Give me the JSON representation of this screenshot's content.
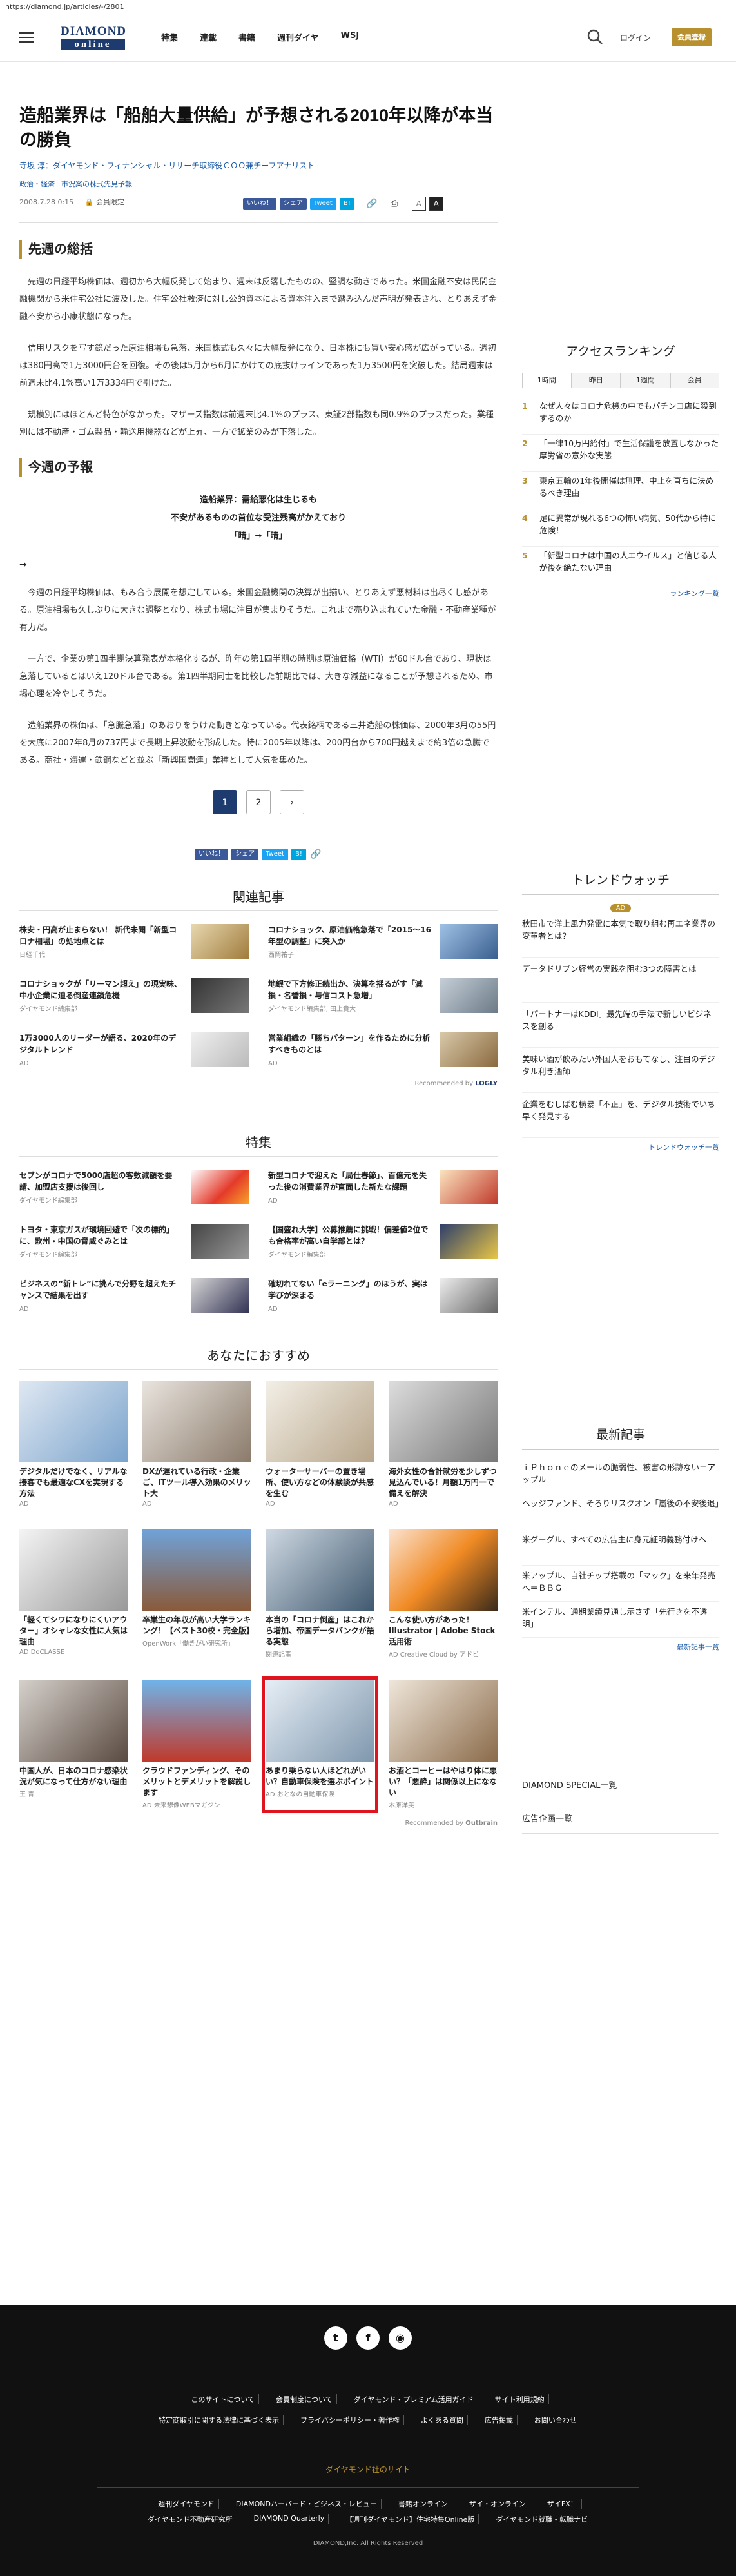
{
  "url": "https://diamond.jp/articles/-/2801",
  "header": {
    "logo_top": "DIAMOND",
    "logo_bottom": "online",
    "nav": [
      "特集",
      "連載",
      "書籍",
      "週刊ダイヤ",
      "WSJ"
    ],
    "login": "ログイン",
    "member": "会員登録"
  },
  "article": {
    "title": "造船業界は「船舶大量供給」が予想される2010年以降が本当の勝負",
    "author": "寺坂 淳：ダイヤモンド・フィナンシャル・リサーチ取締役ＣＯＯ兼チーフアナリスト",
    "tags": [
      "政治・経済",
      "市況案の株式先見予報"
    ],
    "date": "2008.7.28 0:15",
    "member_only": "会員限定",
    "share": {
      "fb": "いいね！",
      "fb2": "シェア",
      "tw": "Tweet",
      "hb": "B!"
    },
    "font_small": "A",
    "font_large": "A",
    "sec1": "先週の総括",
    "p1": "　先週の日経平均株価は、週初から大幅反発して始まり、週末は反落したものの、堅調な動きであった。米国金融不安は民間金融機関から米住宅公社に波及した。住宅公社救済に対し公的資本による資本注入まで踏み込んだ声明が発表され、とりあえず金融不安から小康状態になった。",
    "p2": "　信用リスクを写す鏡だった原油相場も急落、米国株式も久々に大幅反発になり、日本株にも買い安心感が広がっている。週初は380円高で1万3000円台を回復。その後は5月から6月にかけての底抜けラインであった1万3500円を突破した。結局週末は前週末比4.1%高い1万3334円で引けた。",
    "p3": "　規模別にはほとんど特色がなかった。マザーズ指数は前週末比4.1%のプラス、東証2部指数も同0.9%のプラスだった。業種別には不動産・ゴム製品・輸送用機器などが上昇、一方で鉱業のみが下落した。",
    "sec2": "今週の予報",
    "forecast": [
      "造船業界：需給悪化は生じるも",
      "不安があるものの首位な受注残高がかえており",
      "「晴」→「晴」"
    ],
    "arrow": "→",
    "p4": "　今週の日経平均株価は、もみ合う展開を想定している。米国金融機関の決算が出揃い、とりあえず悪材料は出尽くし感がある。原油相場も久しぶりに大きな調整となり、株式市場に注目が集まりそうだ。これまで売り込まれていた金融・不動産業種が有力だ。",
    "p5": "　一方で、企業の第1四半期決算発表が本格化するが、昨年の第1四半期の時期は原油価格（WTI）が60ドル台であり、現状は急落しているとはいえ120ドル台である。第1四半期同士を比較した前期比では、大きな減益になることが予想されるため、市場心理を冷やしそうだ。",
    "p6": "　造船業界の株価は、「急騰急落」のあおりをうけた動きとなっている。代表銘柄である三井造船の株価は、2000年3月の55円を大底に2007年8月の737円まで長期上昇波動を形成した。特に2005年以降は、200円台から700円越えまで約3倍の急騰である。商社・海運・鉄鋼などと並ぶ「新興国関連」業種として人気を集めた。",
    "pages": [
      "1",
      "2",
      "›"
    ]
  },
  "related": {
    "head": "関連記事",
    "items": [
      {
        "t": "株安・円高が止まらない！ 新代未聞「新型コロナ相場」の処地点とは",
        "s": "日経千代"
      },
      {
        "t": "コロナショック、原油価格急落で「2015～16年型の調整」に突入か",
        "s": "西岡祐子"
      },
      {
        "t": "コロナショックが「リーマン超え」の現実味、中小企業に迫る倒産連鎖危機",
        "s": "ダイヤモンド編集部"
      },
      {
        "t": "地銀で下方修正続出か、決算を揺るがす「減損・名誉損・与信コスト急増」",
        "s": "ダイヤモンド編集部, 田上貴大"
      },
      {
        "t": "1万3000人のリーダーが語る、2020年のデジタルトレンド",
        "s": "AD"
      },
      {
        "t": "営業組織の「勝ちパターン」を作るために分析すべきものとは",
        "s": "AD"
      }
    ],
    "rec_by": "Recommended by",
    "rec_brand": "LOGLY"
  },
  "feature": {
    "head": "特集",
    "items": [
      {
        "t": "セブンがコロナで5000店超の客数減額を要請、加盟店支援は後回し",
        "s": "ダイヤモンド編集部"
      },
      {
        "t": "新型コロナで迎えた「局仕春節」、百億元を失った後の消費業界が直面した新たな課題",
        "s": "AD"
      },
      {
        "t": "トヨタ・東京ガスが環境回避で「次の標的」に、欧州・中国の脅威ぐみとは",
        "s": "ダイヤモンド編集部"
      },
      {
        "t": "【国盛れ大学】公募推薦に挑戦！偏差値2位でも合格率が高い自学部とは？",
        "s": "ダイヤモンド編集部"
      },
      {
        "t": "ビジネスの”新トレ”に挑んで分野を超えたチャンスで結果を出す",
        "s": "AD"
      },
      {
        "t": "確切れてない「eラーニング」のほうが、実は学びが深まる",
        "s": "AD"
      }
    ]
  },
  "recommend": {
    "head": "あなたにおすすめ",
    "items": [
      {
        "t": "デジタルだけでなく、リアルな接客でも最適なCXを実現する方法",
        "s": "AD"
      },
      {
        "t": "DXが遅れている行政・企業ご、ITツール導入効果のメリット大",
        "s": "AD"
      },
      {
        "t": "ウォーターサーバーの置き場所、使い方などの体験談が共感を生む",
        "s": "AD"
      },
      {
        "t": "海外女性の合計就労を少しずつ見込んでいる！月額1万円一で備えを解決",
        "s": "AD"
      },
      {
        "t": "「軽くてシワになりにくいアウター」オシャレな女性に人気は理由",
        "s": "AD DoCLASSE"
      },
      {
        "t": "卒業生の年収が高い大学ランキング！【ベスト30校・完全版】",
        "s": "OpenWork「働きがい研究所」"
      },
      {
        "t": "本当の「コロナ倒産」はこれから増加、帝国データバンクが語る実態",
        "s": "関連記事"
      },
      {
        "t": "こんな使い方があった！Illustrator | Adobe Stock活用術",
        "s": "AD Creative Cloud by アドビ"
      },
      {
        "t": "中国人が、日本のコロナ感染状況が気になって仕方がない理由",
        "s": "王 青"
      },
      {
        "t": "クラウドファンディング、そのメリットとデメリットを解説します",
        "s": "AD 未来想像WEBマガジン"
      },
      {
        "t": "あまり乗らない人ほどれがいい？自動車保険を選ぶポイント",
        "s": "AD おとなの自動車保険"
      },
      {
        "t": "お酒とコーヒーはやはり体に悪い？「悪酔」は関係以上になない",
        "s": "木原洋美"
      }
    ],
    "rec_by": "Recommended by",
    "rec_brand": "Outbrain"
  },
  "sidebar": {
    "rank_head": "アクセスランキング",
    "tabs": [
      "1時間",
      "昨日",
      "1週間",
      "会員"
    ],
    "rank": [
      {
        "n": "1",
        "t": "なぜ人々はコロナ危機の中でもパチンコ店に殺到するのか"
      },
      {
        "n": "2",
        "t": "「一律10万円給付」で生活保護を放置しなかった厚労省の意外な実態"
      },
      {
        "n": "3",
        "t": "東京五輪の1年後開催は無理、中止を直ちに決めるべき理由"
      },
      {
        "n": "4",
        "t": "足に異常が現れる6つの怖い病気、50代から特に危険！"
      },
      {
        "n": "5",
        "t": "「新型コロナは中国の人エウイルス」と信じる人が後を絶たない理由"
      }
    ],
    "rank_more": "ランキング一覧",
    "trend_head": "トレンドウォッチ",
    "trend_ad": "AD",
    "trend": [
      "秋田市で洋上風力発電に本気で取り組む再エネ業界の変革者とは？",
      "データドリブン経営の実践を阻む3つの障害とは",
      "「パートナーはKDDI」最先端の手法で新しいビジネスを創る",
      "美味い酒が飲みたい外国人をおもてなし、注目のデジタル利き酒師",
      "企業をむしばむ横暴「不正」を、デジタル技術でいち早く発見する"
    ],
    "trend_more": "トレンドウォッチ一覧",
    "news_head": "最新記事",
    "news": [
      "ｉＰｈｏｎｅのメールの脆弱性、被害の形跡ない＝アップル",
      "ヘッジファンド、そろりリスクオン「嵐後の不安後退」",
      "米グーグル、すべての広告主に身元証明義務付けへ",
      "米アップル、自社チップ搭載の「マック」を来年発売へ＝ＢＢＧ",
      "米インテル、通期業績見通し示さず「先行きを不透明」"
    ],
    "news_more": "最新記事一覧",
    "special": "DIAMOND SPECIAL一覧",
    "ad_page": "広告企画一覧"
  },
  "footer": {
    "row1": [
      "このサイトについて",
      "会員制度について",
      "ダイヤモンド・プレミアム活用ガイド",
      "サイト利用規約"
    ],
    "row2": [
      "特定商取引に関する法律に基づく表示",
      "プライバシーポリシー・著作権",
      "よくある質問",
      "広告掲載",
      "お問い合わせ"
    ],
    "group": "ダイヤモンド社のサイト",
    "row3": [
      "週刊ダイヤモンド",
      "DIAMONDハーバード・ビジネス・レビュー",
      "書籍オンライン",
      "ザイ・オンライン",
      "ザイFX！"
    ],
    "row4": [
      "ダイヤモンド不動産研究所",
      "DIAMOND Quarterly",
      "【週刊ダイヤモンド】住宅特集Online版",
      "ダイヤモンド就職・転職ナビ"
    ],
    "copyright": "DIAMOND,Inc. All Rights Reserved"
  }
}
